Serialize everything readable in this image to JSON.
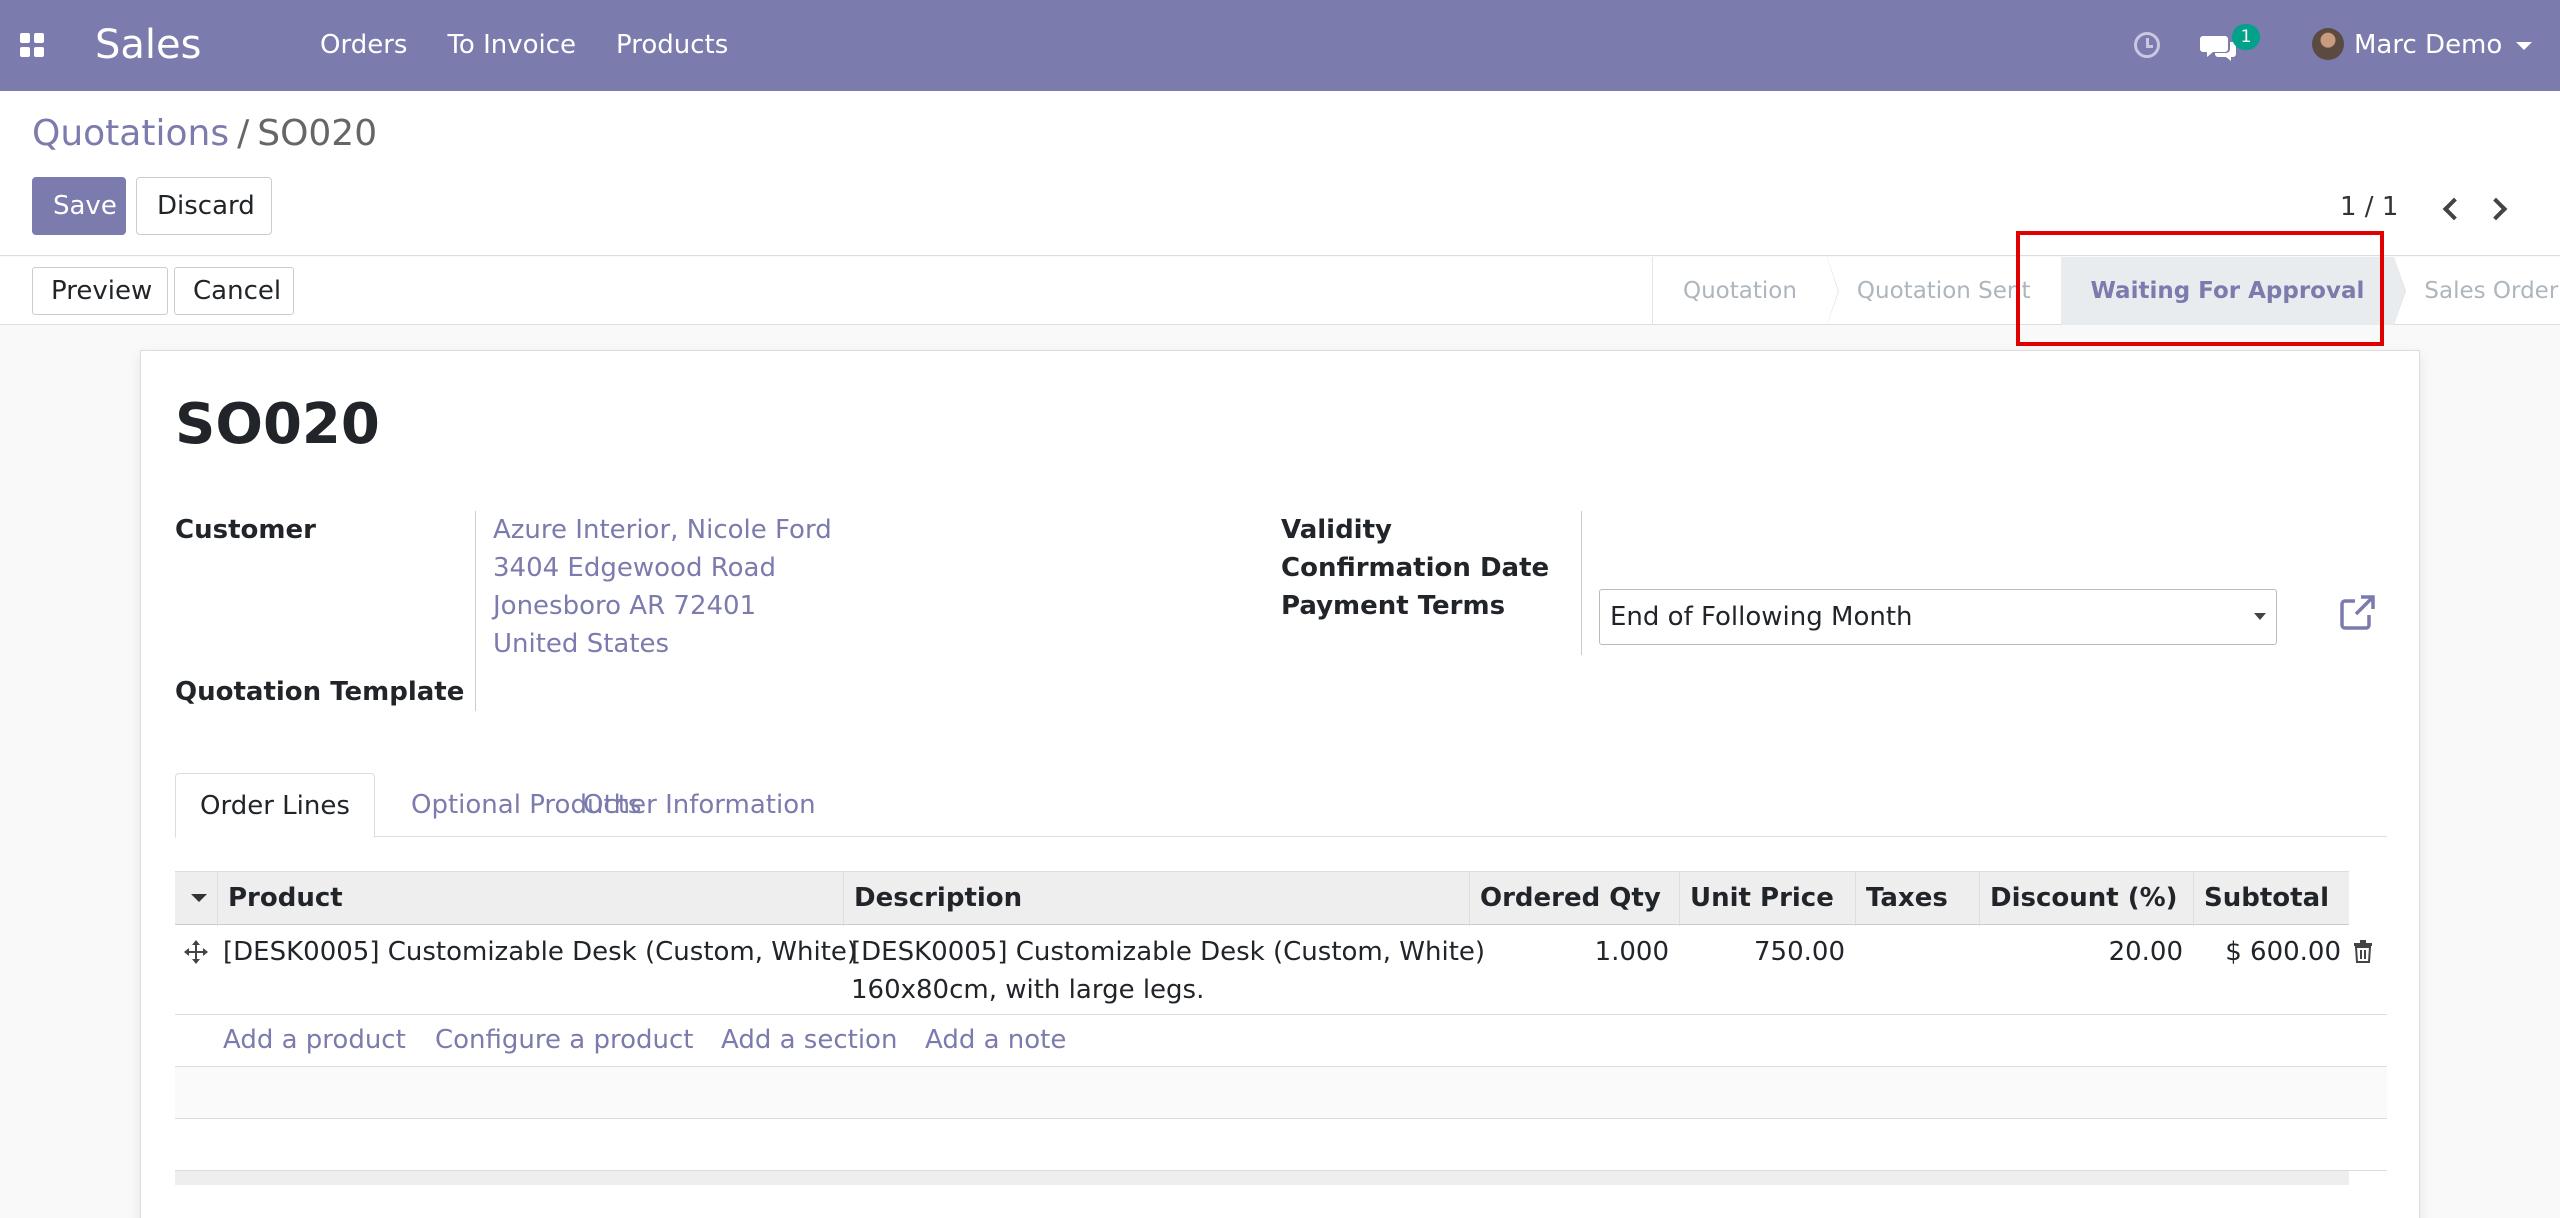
{
  "navbar": {
    "app_name": "Sales",
    "menu": [
      "Orders",
      "To Invoice",
      "Products"
    ],
    "chat_count": "1",
    "user_name": "Marc Demo",
    "icons": [
      "apps-icon",
      "clock-icon",
      "chat-icon",
      "avatar"
    ]
  },
  "breadcrumb": {
    "parent": "Quotations",
    "separator": "/",
    "current": "SO020"
  },
  "actions": {
    "save": "Save",
    "discard": "Discard"
  },
  "pager": {
    "value": "1 / 1"
  },
  "statusbar": {
    "preview": "Preview",
    "cancel": "Cancel",
    "stages": [
      "Quotation",
      "Quotation Sent",
      "Waiting For Approval",
      "Sales Order"
    ],
    "active_stage": "Waiting For Approval"
  },
  "form": {
    "title": "SO020",
    "customer_label": "Customer",
    "customer_lines": [
      "Azure Interior, Nicole Ford",
      "3404 Edgewood Road",
      "Jonesboro AR 72401",
      "United States"
    ],
    "template_label": "Quotation Template",
    "validity_label": "Validity",
    "confirmation_label": "Confirmation Date",
    "payment_terms_label": "Payment Terms",
    "payment_terms_value": "End of Following Month"
  },
  "tabs": [
    "Order Lines",
    "Optional Products",
    "Other Information"
  ],
  "table": {
    "columns": [
      "Product",
      "Description",
      "Ordered Qty",
      "Unit Price",
      "Taxes",
      "Discount (%)",
      "Subtotal"
    ],
    "rows": [
      {
        "product": "[DESK0005] Customizable Desk (Custom, White)",
        "description_line1": "[DESK0005] Customizable Desk (Custom, White)",
        "description_line2": "160x80cm, with large legs.",
        "qty": "1.000",
        "unit_price": "750.00",
        "taxes": "",
        "discount": "20.00",
        "subtotal": "$ 600.00"
      }
    ],
    "add_links": [
      "Add a product",
      "Configure a product",
      "Add a section",
      "Add a note"
    ]
  },
  "colors": {
    "brand": "#7c7bad",
    "highlight": "#e00000",
    "badge": "#01a18a"
  }
}
